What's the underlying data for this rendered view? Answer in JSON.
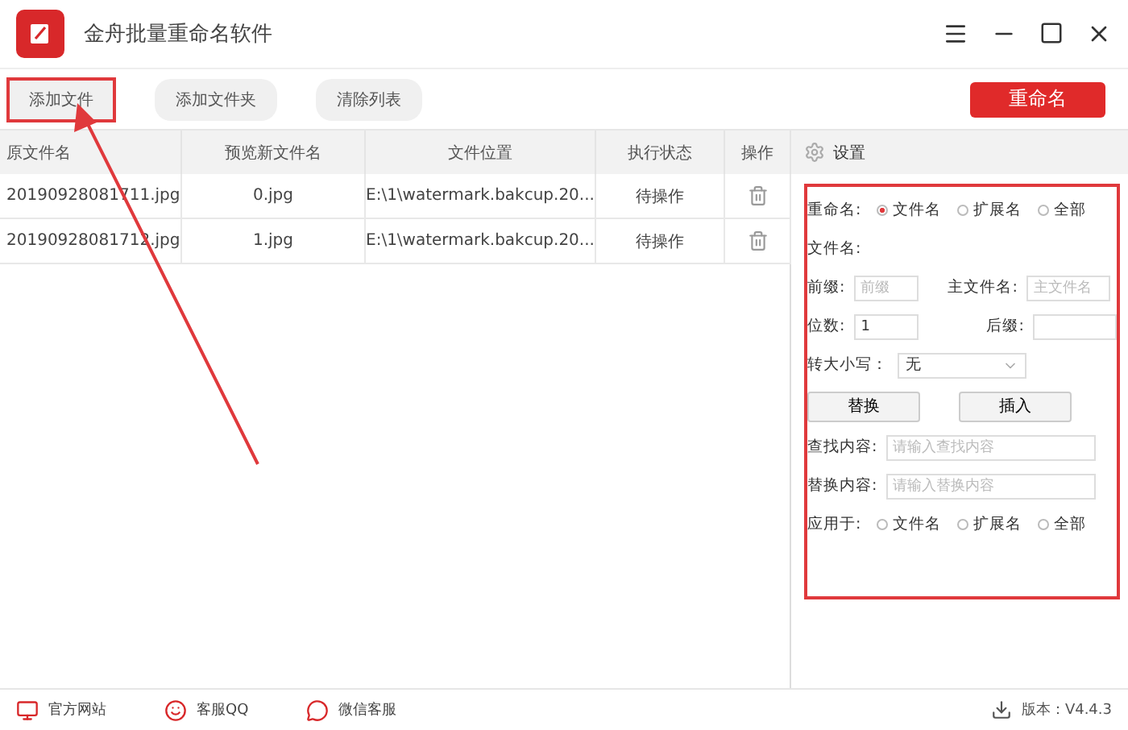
{
  "window": {
    "title": "金舟批量重命名软件"
  },
  "toolbar": {
    "buttons": [
      {
        "label": "添加文件",
        "highlighted": true
      },
      {
        "label": "添加文件夹",
        "highlighted": false
      },
      {
        "label": "清除列表",
        "highlighted": false
      }
    ],
    "primary": "重命名"
  },
  "table": {
    "columns": [
      "原文件名",
      "预览新文件名",
      "文件位置",
      "执行状态",
      "操作"
    ],
    "rows": [
      {
        "original": "20190928081711.jpg",
        "preview": "0.jpg",
        "location": "E:\\1\\watermark.bakcup.20...",
        "status": "待操作"
      },
      {
        "original": "20190928081712.jpg",
        "preview": "1.jpg",
        "location": "E:\\1\\watermark.bakcup.20...",
        "status": "待操作"
      }
    ]
  },
  "settings": {
    "title": "设置",
    "highlighted": true,
    "rename_label": "重命名:",
    "rename_options": [
      {
        "label": "文件名",
        "selected": true
      },
      {
        "label": "扩展名",
        "selected": false
      },
      {
        "label": "全部",
        "selected": false
      }
    ],
    "filename_label": "文件名:",
    "prefix_label": "前缀:",
    "prefix": {
      "placeholder": "前缀"
    },
    "main_label": "主文件名:",
    "main": {
      "placeholder": "主文件名"
    },
    "digits_label": "位数:",
    "digits": {
      "value": "1"
    },
    "suffix_label": "后缀:",
    "case_label": "转大小写：",
    "case_value": "无",
    "action_buttons": [
      "替换",
      "插入"
    ],
    "find_label": "查找内容:",
    "find": {
      "placeholder": "请输入查找内容"
    },
    "replace_label": "替换内容:",
    "replace": {
      "placeholder": "请输入替换内容"
    },
    "apply_label": "应用于:",
    "apply_options": [
      {
        "label": "文件名",
        "selected": false
      },
      {
        "label": "扩展名",
        "selected": false
      },
      {
        "label": "全部",
        "selected": false
      }
    ]
  },
  "footer": {
    "links": [
      {
        "kind": "monitor",
        "label": "官方网站"
      },
      {
        "kind": "qq",
        "label": "客服QQ"
      },
      {
        "kind": "wechat",
        "label": "微信客服"
      }
    ],
    "version": "版本：V4.4.3"
  }
}
